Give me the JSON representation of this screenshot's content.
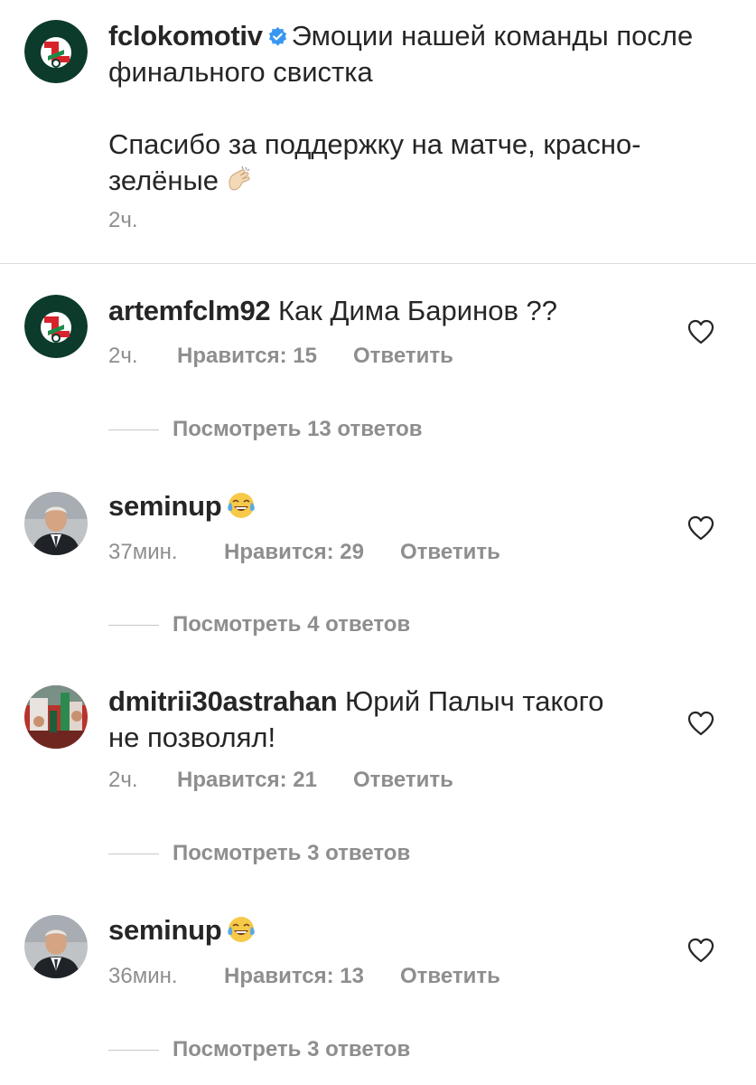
{
  "post": {
    "username": "fclokomotiv",
    "caption_line1": "Эмоции нашей команды после",
    "caption_line2": "финального свистка",
    "caption_line3": "Спасибо за поддержку на матче, красно-",
    "caption_line4": "зелёные",
    "caption_emoji": "clapping-hands-icon",
    "time": "2ч."
  },
  "comments": [
    {
      "username": "artemfclm92",
      "text": "Как Дима Баринов ??",
      "time": "2ч.",
      "likes": "Нравится: 15",
      "reply": "Ответить",
      "view_replies": "Посмотреть 13 ответов"
    },
    {
      "username": "seminup",
      "emoji": "tears-of-joy-icon",
      "time": "37мин.",
      "likes": "Нравится: 29",
      "reply": "Ответить",
      "view_replies": "Посмотреть 4 ответов"
    },
    {
      "username": "dmitrii30astrahan",
      "text": "Юрий Палыч такого",
      "text_line2": "не позволял!",
      "time": "2ч.",
      "likes": "Нравится: 21",
      "reply": "Ответить",
      "view_replies": "Посмотреть 3 ответов"
    },
    {
      "username": "seminup",
      "emoji": "tears-of-joy-icon",
      "time": "36мин.",
      "likes": "Нравится: 13",
      "reply": "Ответить",
      "view_replies": "Посмотреть 3 ответов"
    }
  ],
  "colors": {
    "text": "#262626",
    "secondary": "#8e8e8e",
    "verified": "#3897f0",
    "lokomotiv_green": "#0a5a3a",
    "lokomotiv_red": "#d8232a"
  }
}
